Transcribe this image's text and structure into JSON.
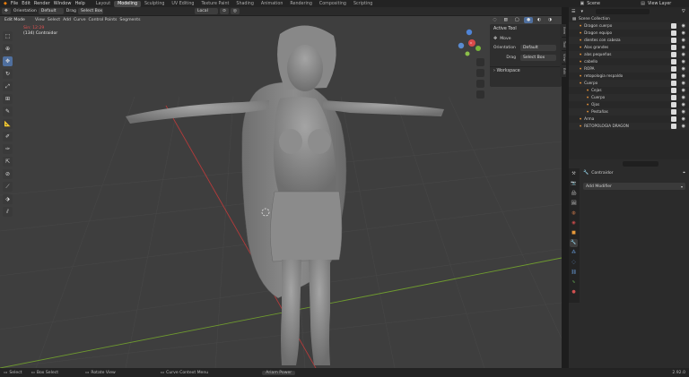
{
  "menu": {
    "items": [
      "File",
      "Edit",
      "Render",
      "Window",
      "Help"
    ],
    "workspaces": [
      "Layout",
      "Modeling",
      "Sculpting",
      "UV Editing",
      "Texture Paint",
      "Shading",
      "Animation",
      "Rendering",
      "Compositing",
      "Scripting"
    ],
    "active_workspace": "Modeling",
    "scene_label": "Scene",
    "view_layer_label": "View Layer"
  },
  "header": {
    "orientation_label": "Orientation",
    "orientation_value": "Default",
    "drag_label": "Drag",
    "drag_value": "Select Box",
    "transform_value": "Local",
    "mode": "Edit Mode",
    "menus": [
      "View",
      "Select",
      "Add",
      "Curve",
      "Control Points",
      "Segments"
    ]
  },
  "viewport": {
    "view_name": "Sin: 12:29",
    "object_line": "(134) Contraidor"
  },
  "npanel": {
    "title": "Active Tool",
    "tool": "Move",
    "orientation_label": "Orientation",
    "orientation_value": "Default",
    "drag_label": "Drag",
    "drag_value": "Select Box",
    "workspace_label": "Workspace",
    "tabs": [
      "Item",
      "Tool",
      "View",
      "Edit"
    ]
  },
  "outliner": {
    "rows": [
      {
        "label": "Scene Collection",
        "depth": 0,
        "color": "#ffffff"
      },
      {
        "label": "Dragon cuerpo",
        "depth": 1,
        "color": "#ff9f3a"
      },
      {
        "label": "Dragon equipo",
        "depth": 1,
        "color": "#ff9f3a"
      },
      {
        "label": "dientes con cabeza",
        "depth": 1,
        "color": "#ff9f3a"
      },
      {
        "label": "Alas grandes",
        "depth": 1,
        "color": "#ff9f3a"
      },
      {
        "label": "alas pequeñas",
        "depth": 1,
        "color": "#ff9f3a"
      },
      {
        "label": "cabello",
        "depth": 1,
        "color": "#ff9f3a"
      },
      {
        "label": "ROPA",
        "depth": 1,
        "color": "#ff9f3a"
      },
      {
        "label": "retopologia respaldo",
        "depth": 1,
        "color": "#ff9f3a"
      },
      {
        "label": "Cuerpo",
        "depth": 1,
        "color": "#ff9f3a"
      },
      {
        "label": "Cejas",
        "depth": 2,
        "color": "#ff9f3a"
      },
      {
        "label": "Cuerpo",
        "depth": 2,
        "color": "#ff9f3a"
      },
      {
        "label": "Ojos",
        "depth": 2,
        "color": "#ff9f3a"
      },
      {
        "label": "Pestañas",
        "depth": 2,
        "color": "#ff9f3a"
      },
      {
        "label": "Arma",
        "depth": 1,
        "color": "#ff9f3a"
      },
      {
        "label": "RETOPOLOGIA DRAGON",
        "depth": 1,
        "color": "#ff9f3a"
      }
    ]
  },
  "properties": {
    "object_name": "Contraidor",
    "add_modifier_label": "Add Modifier"
  },
  "status": {
    "items": [
      "Select",
      "Box Select",
      "Rotate View",
      "Curve Context Menu"
    ],
    "center_label": "Ariam Power",
    "version": "2.92.0"
  },
  "colors": {
    "accent": "#4f6f9e",
    "grid_red": "#b33b3b",
    "grid_green": "#6f9b2f"
  }
}
